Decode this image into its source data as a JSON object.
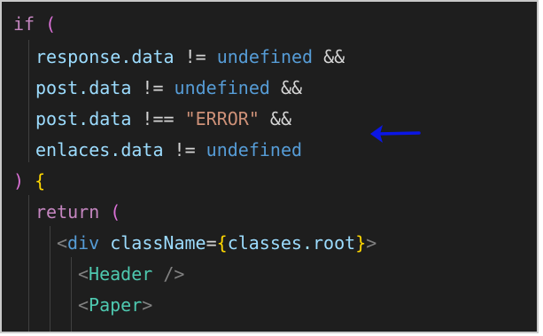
{
  "lines": [
    {
      "tokens": [
        {
          "t": "if",
          "c": "keyword"
        },
        {
          "t": " ",
          "c": "op"
        },
        {
          "t": "(",
          "c": "paren-p"
        }
      ]
    },
    {
      "tokens": [
        {
          "t": "response.data",
          "c": "var"
        },
        {
          "t": " != ",
          "c": "op"
        },
        {
          "t": "undefined",
          "c": "const"
        },
        {
          "t": " &&",
          "c": "op"
        }
      ]
    },
    {
      "tokens": [
        {
          "t": "post.data",
          "c": "var"
        },
        {
          "t": " != ",
          "c": "op"
        },
        {
          "t": "undefined",
          "c": "const"
        },
        {
          "t": " &&",
          "c": "op"
        }
      ]
    },
    {
      "tokens": [
        {
          "t": "post.data",
          "c": "var"
        },
        {
          "t": " !== ",
          "c": "op"
        },
        {
          "t": "\"ERROR\"",
          "c": "str"
        },
        {
          "t": " &&",
          "c": "op"
        }
      ]
    },
    {
      "tokens": [
        {
          "t": "enlaces.data",
          "c": "var"
        },
        {
          "t": " != ",
          "c": "op"
        },
        {
          "t": "undefined",
          "c": "const"
        }
      ]
    },
    {
      "tokens": [
        {
          "t": ")",
          "c": "paren-p"
        },
        {
          "t": " ",
          "c": "op"
        },
        {
          "t": "{",
          "c": "paren-y"
        }
      ]
    },
    {
      "tokens": [
        {
          "t": "return",
          "c": "keyword"
        },
        {
          "t": " ",
          "c": "op"
        },
        {
          "t": "(",
          "c": "paren-p"
        }
      ]
    },
    {
      "tokens": [
        {
          "t": "<",
          "c": "tag"
        },
        {
          "t": "div",
          "c": "html"
        },
        {
          "t": " ",
          "c": "op"
        },
        {
          "t": "className",
          "c": "attr"
        },
        {
          "t": "=",
          "c": "op"
        },
        {
          "t": "{",
          "c": "brace"
        },
        {
          "t": "classes.root",
          "c": "var"
        },
        {
          "t": "}",
          "c": "brace"
        },
        {
          "t": ">",
          "c": "tag"
        }
      ]
    },
    {
      "tokens": [
        {
          "t": "<",
          "c": "tag"
        },
        {
          "t": "Header",
          "c": "comp"
        },
        {
          "t": " />",
          "c": "tag"
        }
      ]
    },
    {
      "tokens": [
        {
          "t": "<",
          "c": "tag"
        },
        {
          "t": "Paper",
          "c": "comp"
        },
        {
          "t": ">",
          "c": "tag"
        }
      ]
    }
  ],
  "arrow": {
    "color": "#0b16e6",
    "icon": "left-arrow-icon"
  }
}
